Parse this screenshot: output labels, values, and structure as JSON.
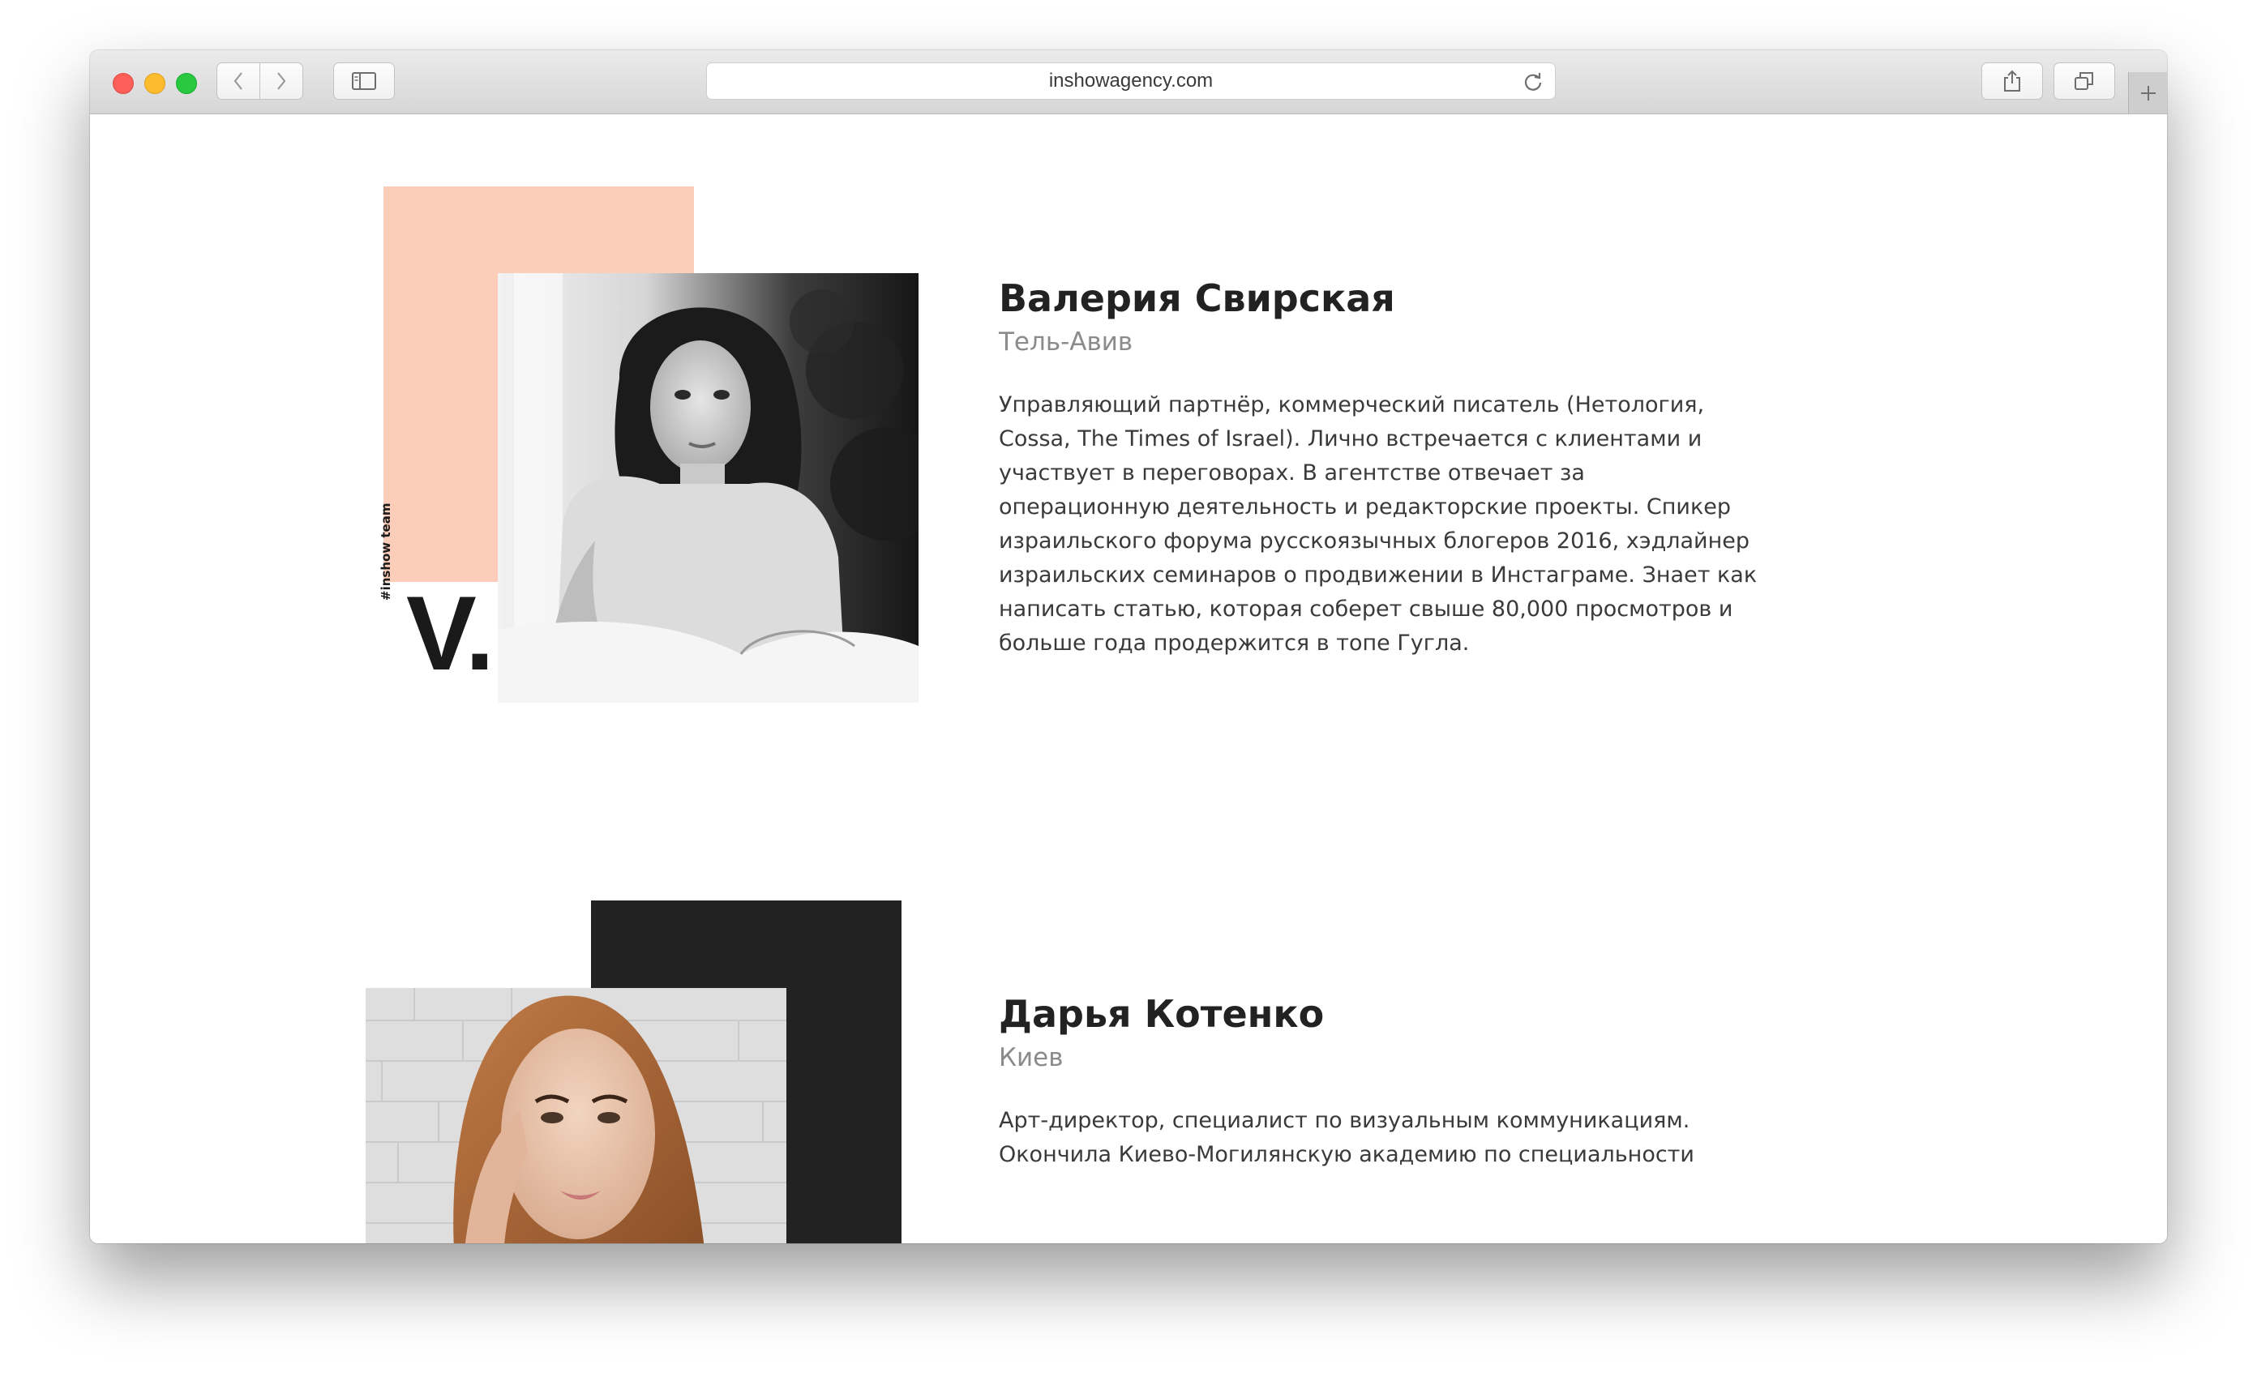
{
  "browser": {
    "url": "inshowagency.com"
  },
  "colors": {
    "peach_accent": "#fccdb9",
    "dark_accent": "#222222",
    "text_primary": "#222222",
    "text_secondary": "#8b8b8b"
  },
  "profiles": [
    {
      "monogram": "V.",
      "tag": "#inshow team",
      "name": "Валерия Свирская",
      "city": "Тель-Авив",
      "bio": "Управляющий партнёр, коммерческий писатель (Нетология, Cossa, The Times of Israel). Лично встречается с клиентами и участвует в переговорах. В агентстве отвечает за операционную деятельность и редакторские проекты. Спикер израильского форума русскоязычных блогеров 2016, хэдлайнер израильских семинаров о продвижении в Инстаграме. Знает как написать статью, которая соберет свыше 80,000 просмотров и больше года продержится в топе Гугла."
    },
    {
      "name": "Дарья Котенко",
      "city": "Киев",
      "bio": "Арт-директор, специалист по визуальным коммуникациям. Окончила Киево-Могилянскую академию по специальности"
    }
  ],
  "icons": {
    "back": "chevron-left-icon",
    "forward": "chevron-right-icon",
    "sidebar": "sidebar-icon",
    "reload": "reload-icon",
    "share": "share-icon",
    "tabs": "tabs-icon",
    "new_tab": "plus-icon"
  }
}
